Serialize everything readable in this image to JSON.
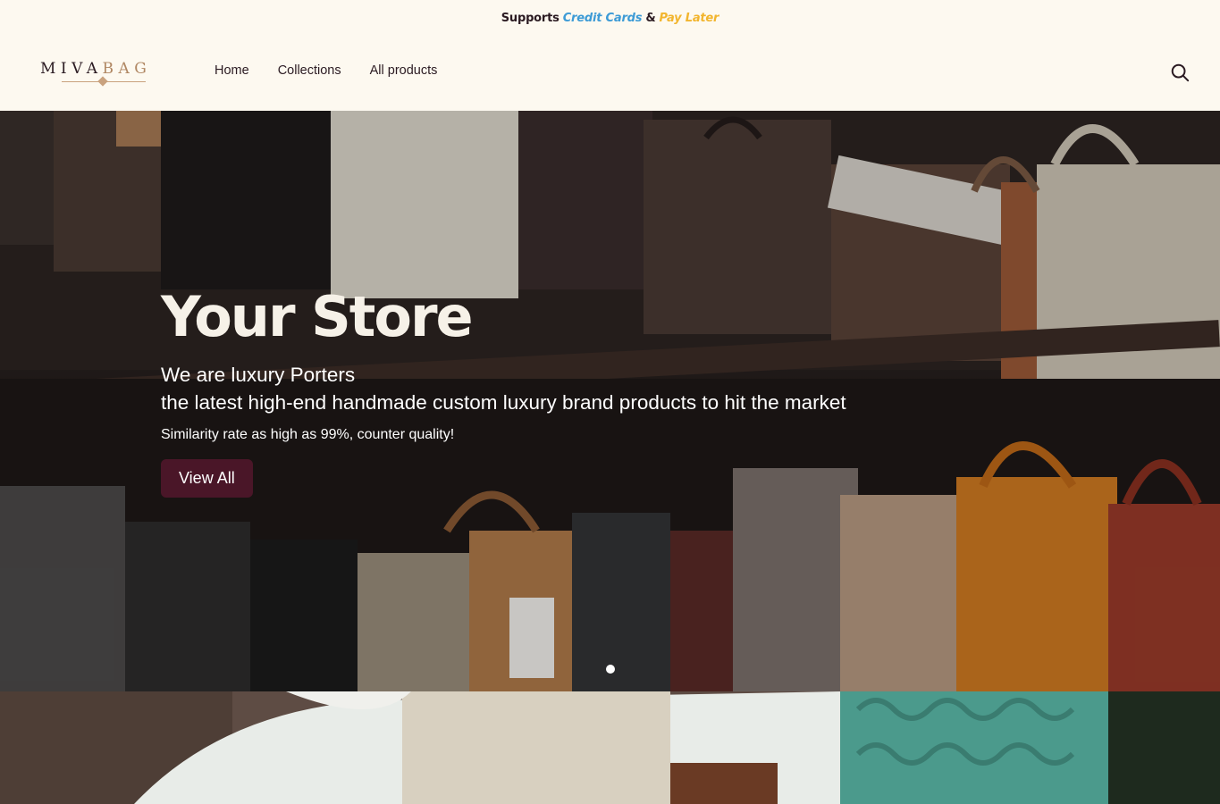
{
  "announcement": {
    "prefix": "Supports",
    "credit": "Credit Cards",
    "amp": "&",
    "pay_later": "Pay Later"
  },
  "logo": {
    "text_a": "MIVA",
    "text_b": "BAG"
  },
  "nav": {
    "home": "Home",
    "collections": "Collections",
    "all_products": "All products"
  },
  "header_icons": {
    "search": "search-icon"
  },
  "hero": {
    "title": "Your Store",
    "subtitle_line1": "We are luxury Porters",
    "subtitle_line2": "the latest high-end handmade custom luxury brand products to hit the market",
    "note": "Similarity rate as high as 99%, counter quality!",
    "cta": "View All",
    "slide_count": 1,
    "active_slide": 1
  },
  "colors": {
    "background": "#fdf9f0",
    "text": "#2b1b22",
    "credit": "#3d9bd6",
    "pay_later": "#f2b52e",
    "cta": "#4a1628",
    "logo_accent": "#b08763"
  }
}
